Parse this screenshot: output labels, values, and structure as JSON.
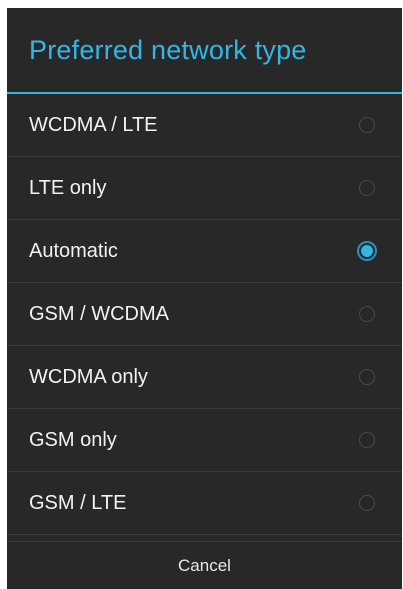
{
  "dialog": {
    "title": "Preferred network type",
    "accent_color": "#33b5e5",
    "options": [
      {
        "label": "WCDMA / LTE",
        "selected": false
      },
      {
        "label": "LTE only",
        "selected": false
      },
      {
        "label": "Automatic",
        "selected": true
      },
      {
        "label": "GSM / WCDMA",
        "selected": false
      },
      {
        "label": "WCDMA only",
        "selected": false
      },
      {
        "label": "GSM only",
        "selected": false
      },
      {
        "label": "GSM / LTE",
        "selected": false
      }
    ],
    "cancel_label": "Cancel"
  }
}
